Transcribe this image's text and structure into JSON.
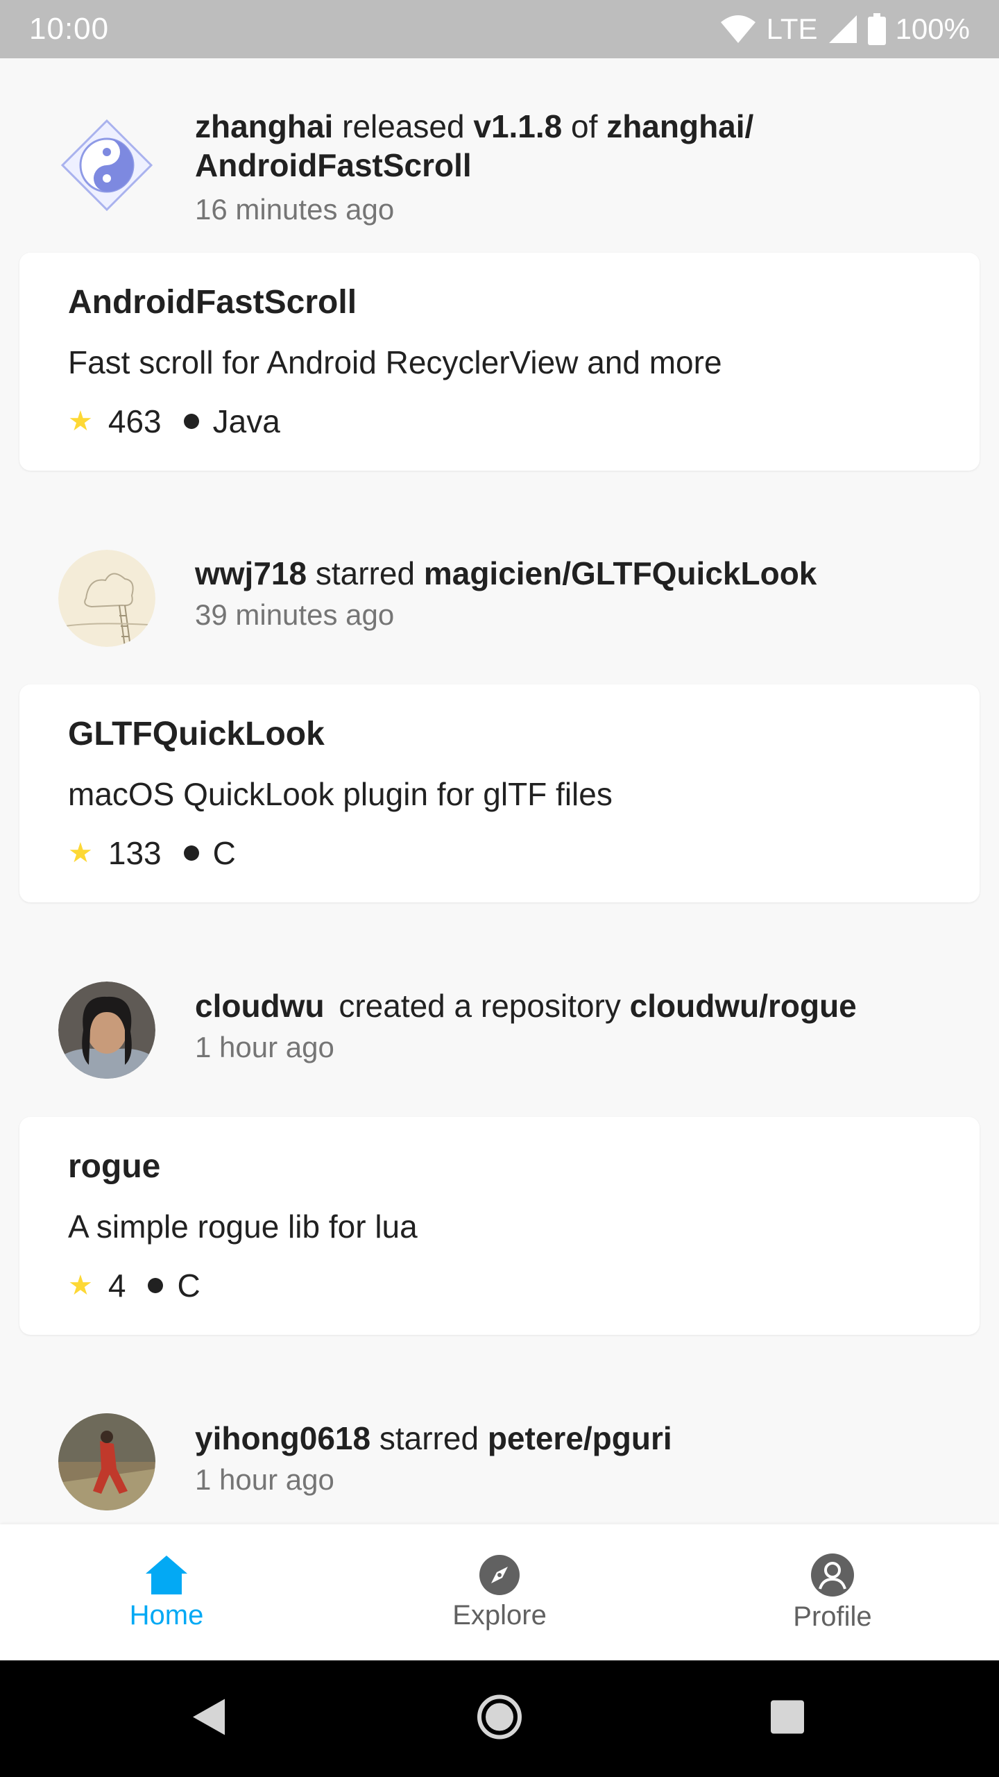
{
  "status_bar": {
    "time": "10:00",
    "network": "LTE",
    "battery": "100%"
  },
  "feed": [
    {
      "actor": "zhanghai",
      "action_prefix": "released",
      "version": "v1.1.8",
      "action_mid": "of",
      "target_line1": "zhanghai/",
      "target_line2": "AndroidFastScroll",
      "time": "16 minutes ago",
      "repo": {
        "name": "AndroidFastScroll",
        "description": "Fast scroll for Android RecyclerView and more",
        "stars": "463",
        "language": "Java"
      }
    },
    {
      "actor": "wwj718",
      "action": "starred",
      "target": "magicien/GLTFQuickLook",
      "time": "39 minutes ago",
      "repo": {
        "name": "GLTFQuickLook",
        "description": "macOS QuickLook plugin for glTF files",
        "stars": "133",
        "language": "C"
      }
    },
    {
      "actor": "cloudwu",
      "action": "created a repository",
      "target": "cloudwu/rogue",
      "time": "1 hour ago",
      "repo": {
        "name": "rogue",
        "description": "A simple rogue lib for lua",
        "stars": "4",
        "language": "C"
      }
    },
    {
      "actor": "yihong0618",
      "action": "starred",
      "target": "petere/pguri",
      "time": "1 hour ago"
    }
  ],
  "bottom_nav": {
    "home": "Home",
    "explore": "Explore",
    "profile": "Profile"
  },
  "colors": {
    "accent": "#03a9f4",
    "inactive": "#616161",
    "star": "#fdd835"
  }
}
